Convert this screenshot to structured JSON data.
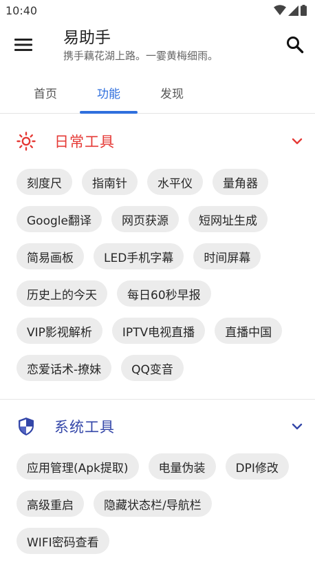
{
  "status_bar": {
    "time": "10:40"
  },
  "app_bar": {
    "title": "易助手",
    "subtitle": "携手藕花湖上路。一霎黄梅细雨。",
    "menu_icon": "menu-icon",
    "search_icon": "search-icon"
  },
  "tabs": [
    {
      "label": "首页",
      "active": false
    },
    {
      "label": "功能",
      "active": true
    },
    {
      "label": "发现",
      "active": false
    }
  ],
  "sections": [
    {
      "id": "daily",
      "title": "日常工具",
      "icon": "sun-icon",
      "color": "#e53935",
      "expanded": true,
      "items": [
        "刻度尺",
        "指南针",
        "水平仪",
        "量角器",
        "Google翻译",
        "网页获源",
        "短网址生成",
        "简易画板",
        "LED手机字幕",
        "时间屏幕",
        "历史上的今天",
        "每日60秒早报",
        "VIP影视解析",
        "IPTV电视直播",
        "直播中国",
        "恋爱话术-撩妹",
        "QQ变音"
      ]
    },
    {
      "id": "system",
      "title": "系统工具",
      "icon": "shield-icon",
      "color": "#3346a8",
      "expanded": true,
      "items": [
        "应用管理(Apk提取)",
        "电量伪装",
        "DPI修改",
        "高级重启",
        "隐藏状态栏/导航栏",
        "WIFI密码查看"
      ]
    }
  ],
  "colors": {
    "accent": "#2f6fdd",
    "chip_bg": "#ececec"
  }
}
